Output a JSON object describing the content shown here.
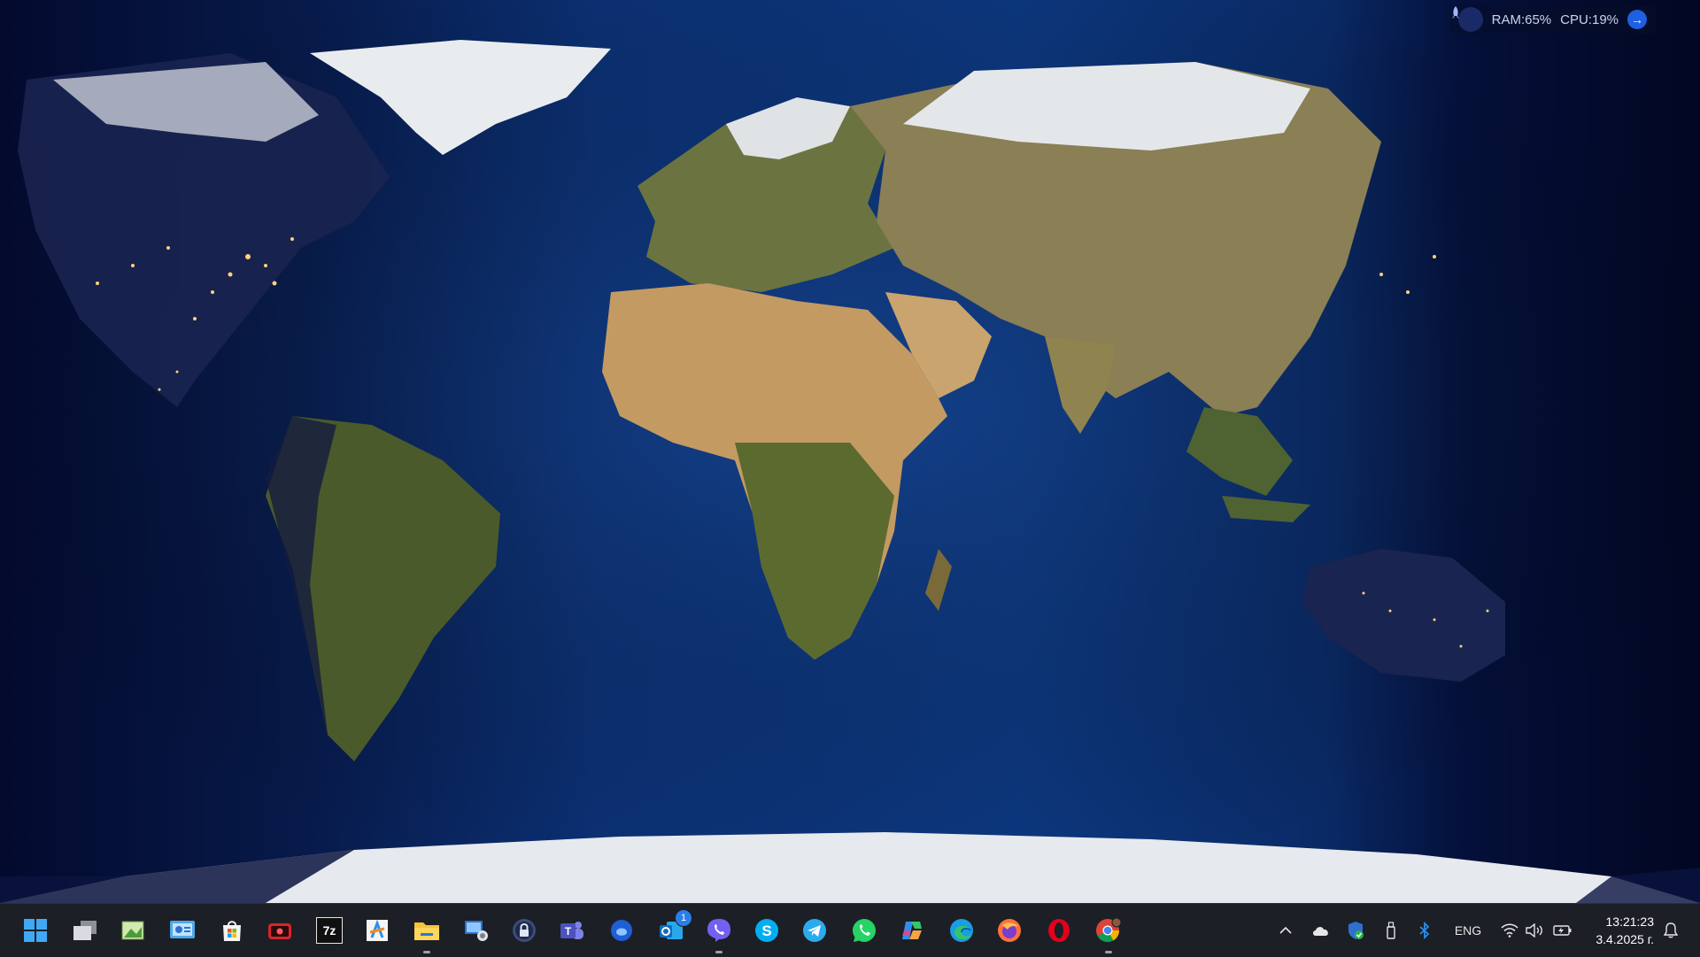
{
  "widget": {
    "ram": "RAM:65%",
    "cpu": "CPU:19%"
  },
  "taskbar": {
    "apps": [
      {
        "name": "start",
        "icon": "windows-logo-icon"
      },
      {
        "name": "task-view",
        "icon": "task-view-icon"
      },
      {
        "name": "photo-editor",
        "icon": "photo-icon"
      },
      {
        "name": "control-panel",
        "icon": "control-panel-icon"
      },
      {
        "name": "microsoft-store",
        "icon": "store-icon"
      },
      {
        "name": "screen-recorder",
        "icon": "recorder-icon"
      },
      {
        "name": "7zip",
        "icon": "7zip-icon",
        "label": "7z"
      },
      {
        "name": "image-app",
        "icon": "image-app-icon"
      },
      {
        "name": "file-explorer",
        "icon": "folder-icon"
      },
      {
        "name": "remote-desktop",
        "icon": "remote-desktop-icon"
      },
      {
        "name": "vpn",
        "icon": "lock-icon"
      },
      {
        "name": "teams",
        "icon": "teams-icon"
      },
      {
        "name": "shield-app",
        "icon": "shield-app-icon"
      },
      {
        "name": "outlook",
        "icon": "outlook-icon",
        "badge": "1"
      },
      {
        "name": "viber",
        "icon": "viber-icon"
      },
      {
        "name": "skype",
        "icon": "skype-icon"
      },
      {
        "name": "telegram",
        "icon": "telegram-icon"
      },
      {
        "name": "whatsapp",
        "icon": "whatsapp-icon"
      },
      {
        "name": "copilot",
        "icon": "copilot-icon"
      },
      {
        "name": "edge",
        "icon": "edge-icon"
      },
      {
        "name": "firefox",
        "icon": "firefox-icon"
      },
      {
        "name": "opera",
        "icon": "opera-icon"
      },
      {
        "name": "chrome",
        "icon": "chrome-icon"
      }
    ],
    "tray": {
      "language": "ENG",
      "time": "13:21:23",
      "date": "3.4.2025 г."
    }
  },
  "colors": {
    "taskbar_bg": "#1c1f26",
    "ocean": "#0b2a66",
    "night": "#020722"
  }
}
